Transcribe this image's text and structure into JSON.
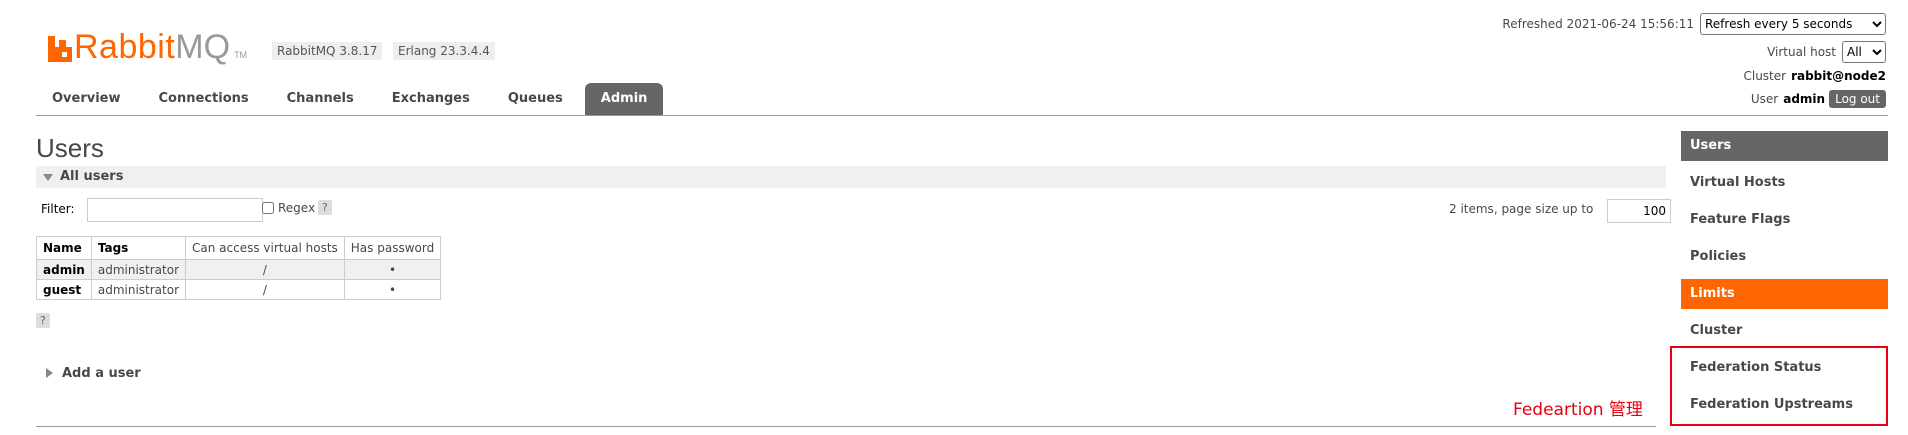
{
  "logo": {
    "word1": "Rabbit",
    "word2": "MQ",
    "tm": "TM"
  },
  "versions": {
    "rabbitmq": "RabbitMQ 3.8.17",
    "erlang": "Erlang 23.3.4.4"
  },
  "status": {
    "refreshed": "Refreshed 2021-06-24 15:56:11",
    "refresh_option": "Refresh every 5 seconds",
    "vhost_label": "Virtual host",
    "vhost_value": "All",
    "cluster_label": "Cluster",
    "cluster_value": "rabbit@node2",
    "user_label": "User",
    "user_value": "admin",
    "logout": "Log out"
  },
  "nav": {
    "tabs": [
      {
        "label": "Overview"
      },
      {
        "label": "Connections"
      },
      {
        "label": "Channels"
      },
      {
        "label": "Exchanges"
      },
      {
        "label": "Queues"
      },
      {
        "label": "Admin"
      }
    ]
  },
  "main": {
    "title": "Users",
    "section": "All users",
    "filter_label": "Filter:",
    "regex_label": "Regex",
    "help": "?",
    "items_text": "2 items, page size up to",
    "page_size": "100",
    "columns": [
      "Name",
      "Tags",
      "Can access virtual hosts",
      "Has password"
    ],
    "rows": [
      {
        "name": "admin",
        "tags": "administrator",
        "vhosts": "/",
        "password": "•"
      },
      {
        "name": "guest",
        "tags": "administrator",
        "vhosts": "/",
        "password": "•"
      }
    ],
    "add_user": "Add a user"
  },
  "admin_menu": {
    "items": [
      {
        "label": "Users"
      },
      {
        "label": "Virtual Hosts"
      },
      {
        "label": "Feature Flags"
      },
      {
        "label": "Policies"
      },
      {
        "label": "Limits"
      },
      {
        "label": "Cluster"
      },
      {
        "label": "Federation Status"
      },
      {
        "label": "Federation Upstreams"
      }
    ]
  },
  "annotation": "Fedeartion 管理",
  "colors": {
    "brand": "#ff6600",
    "tab_active": "#666666",
    "annotation": "#e60012"
  }
}
